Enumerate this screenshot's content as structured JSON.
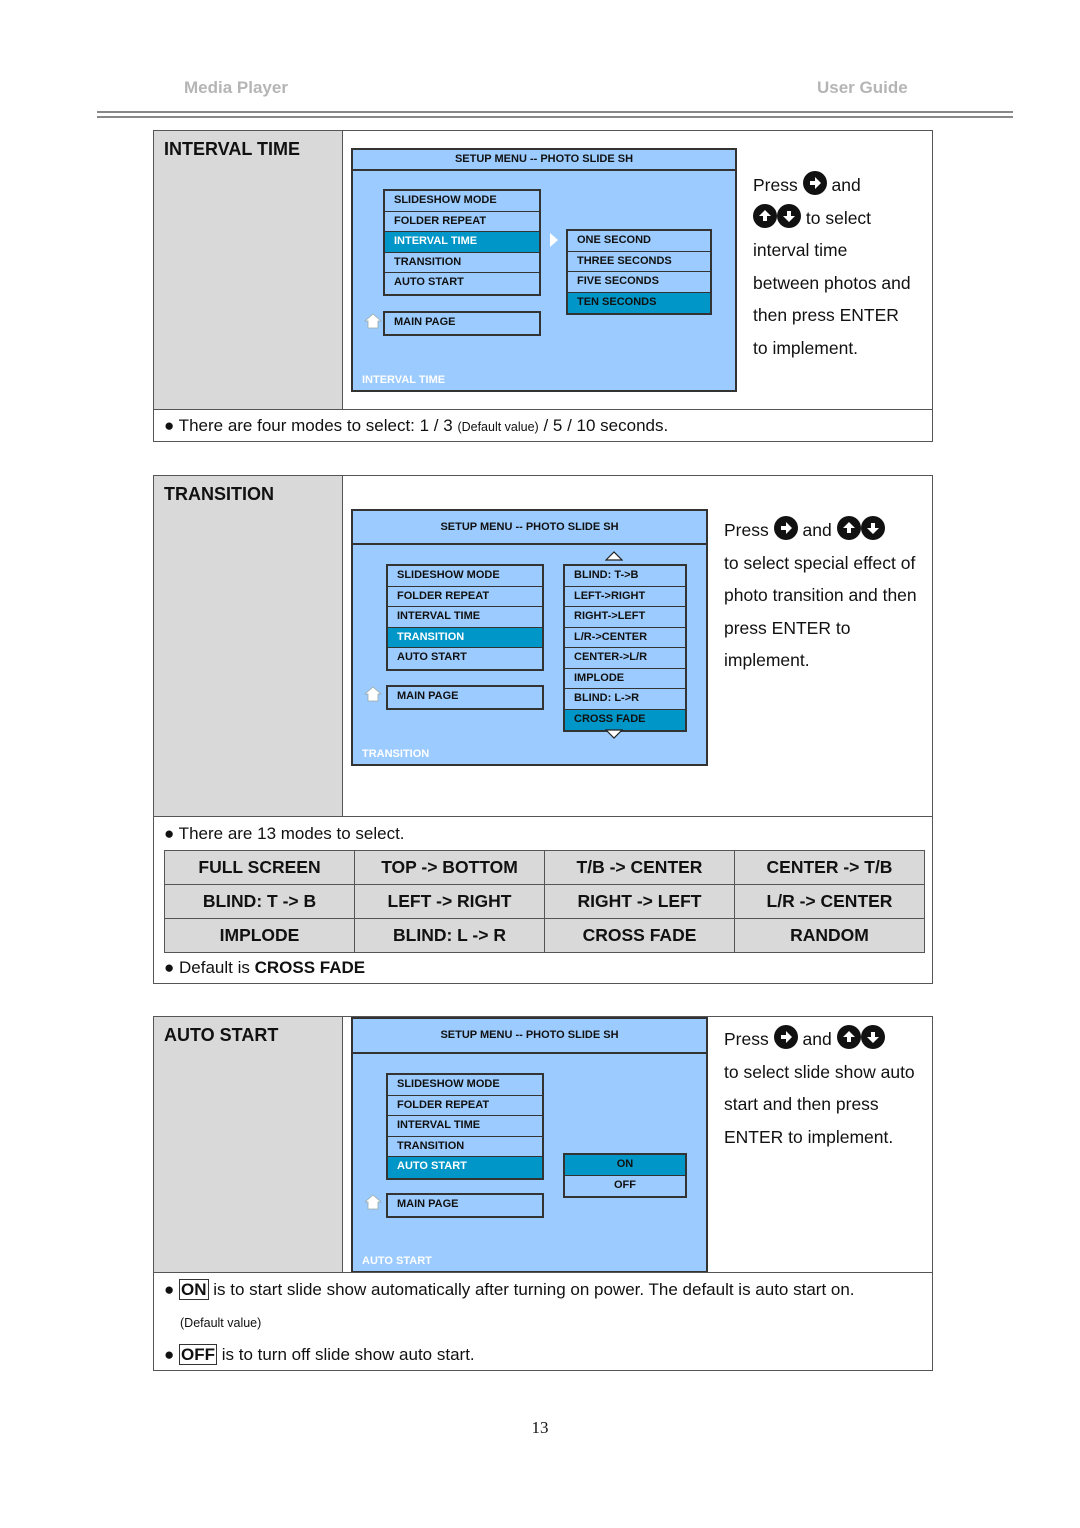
{
  "header": {
    "left": "Media  Player",
    "right": "User  Guide"
  },
  "interval_section": {
    "title": "INTERVAL TIME",
    "osd": {
      "header": "SETUP MENU -- PHOTO SLIDE SH",
      "menu_items": [
        "SLIDESHOW MODE",
        "FOLDER REPEAT",
        "INTERVAL TIME",
        "TRANSITION",
        "AUTO START"
      ],
      "selected_menu": "INTERVAL TIME",
      "main_page": "MAIN PAGE",
      "options": [
        "ONE SECOND",
        "THREE SECONDS",
        "FIVE SECONDS",
        "TEN SECONDS"
      ],
      "selected_option": "TEN SECONDS",
      "footer": "INTERVAL TIME"
    },
    "desc": {
      "press": "Press",
      "and": "and",
      "line2": "to select",
      "rest": [
        "interval time",
        "between photos and",
        "then press ENTER",
        "to implement."
      ]
    },
    "note": {
      "prefix": "● There are four modes to select: 1 / 3 ",
      "small": "(Default value)",
      "suffix": " / 5 / 10 seconds."
    }
  },
  "transition_section": {
    "title": "TRANSITION",
    "osd": {
      "header": "SETUP MENU -- PHOTO SLIDE SH",
      "menu_items": [
        "SLIDESHOW MODE",
        "FOLDER REPEAT",
        "INTERVAL TIME",
        "TRANSITION",
        "AUTO START"
      ],
      "selected_menu": "TRANSITION",
      "main_page": "MAIN PAGE",
      "options": [
        "BLIND: T->B",
        "LEFT->RIGHT",
        "RIGHT->LEFT",
        "L/R->CENTER",
        "CENTER->L/R",
        "IMPLODE",
        "BLIND: L->R",
        "CROSS FADE"
      ],
      "selected_option": "CROSS FADE",
      "footer": "TRANSITION"
    },
    "desc": {
      "press": "Press",
      "and": "and",
      "rest": [
        "to select special effect of",
        "photo transition and then",
        "press ENTER to",
        "implement."
      ]
    },
    "note": "● There are 13 modes to select.",
    "modes": [
      [
        "FULL SCREEN",
        "TOP -> BOTTOM",
        "T/B -> CENTER",
        "CENTER -> T/B"
      ],
      [
        "BLIND: T -> B",
        "LEFT -> RIGHT",
        "RIGHT -> LEFT",
        "L/R -> CENTER"
      ],
      [
        "IMPLODE",
        "BLIND: L -> R",
        "CROSS FADE",
        "RANDOM"
      ]
    ],
    "default_prefix": "● Default is ",
    "default_value": "CROSS FADE"
  },
  "autostart_section": {
    "title": "AUTO START",
    "osd": {
      "header": "SETUP MENU -- PHOTO SLIDE SH",
      "menu_items": [
        "SLIDESHOW MODE",
        "FOLDER REPEAT",
        "INTERVAL TIME",
        "TRANSITION",
        "AUTO START"
      ],
      "selected_menu": "AUTO START",
      "main_page": "MAIN PAGE",
      "options": [
        "ON",
        "OFF"
      ],
      "selected_option": "ON",
      "footer": "AUTO START"
    },
    "desc": {
      "press": "Press",
      "and": "and",
      "rest": [
        "to select slide show auto",
        "start and then press",
        "ENTER to implement."
      ]
    },
    "on_note": {
      "bullet": "● ",
      "keyword": "ON",
      "text": " is to start slide show automatically after turning on power. The default is auto start on."
    },
    "default_value_note": "(Default value)",
    "off_note": {
      "bullet": "● ",
      "keyword": "OFF",
      "text": " is to turn off slide show auto start."
    }
  },
  "page_number": "13",
  "colors": {
    "osd_bg": "#9ccbff",
    "osd_selected": "#0096c8",
    "label_gray": "#d9d9d9",
    "header_gray": "#b5b5b5"
  }
}
